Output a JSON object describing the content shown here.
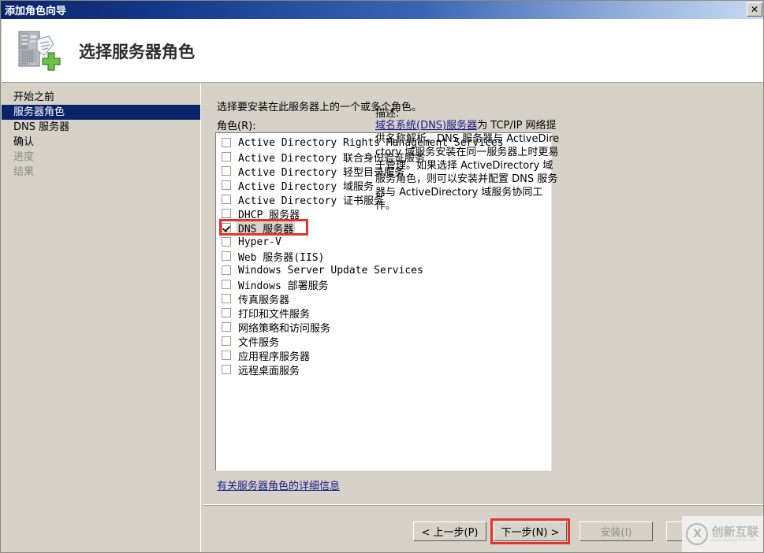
{
  "window": {
    "title": "添加角色向导",
    "close_label": "✕"
  },
  "header": {
    "title": "选择服务器角色",
    "icon": "server-add-icon"
  },
  "sidebar": {
    "items": [
      {
        "label": "开始之前",
        "state": "normal"
      },
      {
        "label": "服务器角色",
        "state": "selected"
      },
      {
        "label": "DNS 服务器",
        "state": "normal"
      },
      {
        "label": "确认",
        "state": "normal"
      },
      {
        "label": "进度",
        "state": "disabled"
      },
      {
        "label": "结果",
        "state": "disabled"
      }
    ]
  },
  "main": {
    "instruction": "选择要安装在此服务器上的一个或多个角色。",
    "roles_label": "角色(R):",
    "roles": [
      {
        "label": "Active Directory Rights Management Services",
        "checked": false
      },
      {
        "label": "Active Directory 联合身份验证服务",
        "checked": false
      },
      {
        "label": "Active Directory 轻型目录服务",
        "checked": false
      },
      {
        "label": "Active Directory 域服务",
        "checked": false
      },
      {
        "label": "Active Directory 证书服务",
        "checked": false
      },
      {
        "label": "DHCP 服务器",
        "checked": false
      },
      {
        "label": "DNS 服务器",
        "checked": true,
        "annotated": true
      },
      {
        "label": "Hyper-V",
        "checked": false
      },
      {
        "label": "Web 服务器(IIS)",
        "checked": false
      },
      {
        "label": "Windows Server Update Services",
        "checked": false
      },
      {
        "label": "Windows 部署服务",
        "checked": false
      },
      {
        "label": "传真服务器",
        "checked": false
      },
      {
        "label": "打印和文件服务",
        "checked": false
      },
      {
        "label": "网络策略和访问服务",
        "checked": false
      },
      {
        "label": "文件服务",
        "checked": false
      },
      {
        "label": "应用程序服务器",
        "checked": false
      },
      {
        "label": "远程桌面服务",
        "checked": false
      }
    ],
    "more_info_link": "有关服务器角色的详细信息"
  },
  "description": {
    "title": "描述:",
    "link_text": "域名系统(DNS)服务器",
    "body": "为 TCP/IP 网络提供名称解析。DNS 服务器与 ActiveDirectory 域服务安装在同一服务器上时更易于管理。如果选择 ActiveDirectory 域服务角色，则可以安装并配置 DNS 服务器与 ActiveDirectory 域服务协同工作。"
  },
  "footer": {
    "prev_label": "< 上一步(P)",
    "next_label": "下一步(N) >",
    "install_label": "安装(I)",
    "cancel_label": ""
  },
  "watermark": {
    "text": "创新互联",
    "subtext": "CHUANGXIN HULIAN"
  },
  "colors": {
    "titlebar_start": "#0a246a",
    "titlebar_end": "#c9daf0",
    "selection": "#0a246a",
    "annotation": "#e8322c",
    "link": "#19198c",
    "dialog_bg": "#d6d2c8"
  }
}
